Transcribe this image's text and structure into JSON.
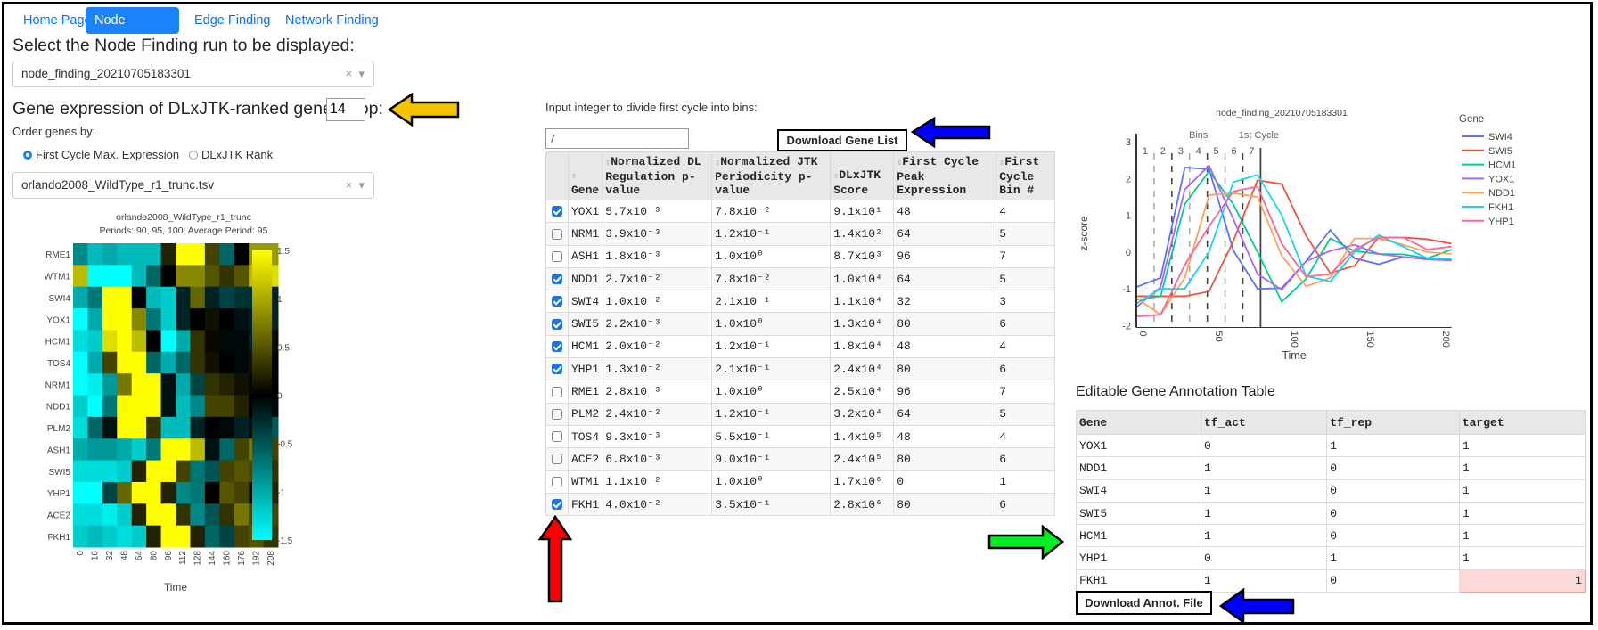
{
  "nav": {
    "tabs": [
      {
        "label": "Home Page",
        "active": false
      },
      {
        "label": "Node Finding",
        "active": true
      },
      {
        "label": "Edge Finding",
        "active": false
      },
      {
        "label": "Network Finding",
        "active": false
      }
    ]
  },
  "left": {
    "run_heading": "Select the Node Finding run to be displayed:",
    "run_select_value": "node_finding_20210705183301",
    "clear_icon": "×",
    "caret_icon": "▾",
    "expr_heading": "Gene expression of DLxJTK-ranked genes. Top:",
    "top_value": "14",
    "order_label": "Order genes by:",
    "order_options": [
      {
        "label": "First Cycle Max. Expression",
        "selected": true
      },
      {
        "label": "DLxJTK Rank",
        "selected": false
      }
    ],
    "dataset_select_value": "orlando2008_WildType_r1_trunc.tsv"
  },
  "middle": {
    "bins_label": "Input integer to divide first cycle into bins:",
    "bins_value": "7",
    "download_gene_list": "Download Gene List",
    "columns": [
      "Gene",
      "Normalized DL Regulation p-value",
      "Normalized JTK Periodicity p-value",
      "DLxJTK Score",
      "First Cycle Peak Expression",
      "First Cycle Bin #"
    ],
    "rows": [
      {
        "checked": true,
        "gene": "YOX1",
        "dl": "5.7x10⁻³",
        "jtk": "7.8x10⁻²",
        "score": "9.1x10¹",
        "peak": "48",
        "bin": "4"
      },
      {
        "checked": false,
        "gene": "NRM1",
        "dl": "3.9x10⁻³",
        "jtk": "1.2x10⁻¹",
        "score": "1.4x10²",
        "peak": "64",
        "bin": "5"
      },
      {
        "checked": false,
        "gene": "ASH1",
        "dl": "1.8x10⁻³",
        "jtk": "1.0x10⁰",
        "score": "8.7x10³",
        "peak": "96",
        "bin": "7"
      },
      {
        "checked": true,
        "gene": "NDD1",
        "dl": "2.7x10⁻²",
        "jtk": "7.8x10⁻²",
        "score": "1.0x10⁴",
        "peak": "64",
        "bin": "5"
      },
      {
        "checked": true,
        "gene": "SWI4",
        "dl": "1.0x10⁻²",
        "jtk": "2.1x10⁻¹",
        "score": "1.1x10⁴",
        "peak": "32",
        "bin": "3"
      },
      {
        "checked": true,
        "gene": "SWI5",
        "dl": "2.2x10⁻³",
        "jtk": "1.0x10⁰",
        "score": "1.3x10⁴",
        "peak": "80",
        "bin": "6"
      },
      {
        "checked": true,
        "gene": "HCM1",
        "dl": "2.0x10⁻²",
        "jtk": "1.2x10⁻¹",
        "score": "1.8x10⁴",
        "peak": "48",
        "bin": "4"
      },
      {
        "checked": true,
        "gene": "YHP1",
        "dl": "1.3x10⁻²",
        "jtk": "2.1x10⁻¹",
        "score": "2.4x10⁴",
        "peak": "80",
        "bin": "6"
      },
      {
        "checked": false,
        "gene": "RME1",
        "dl": "2.8x10⁻³",
        "jtk": "1.0x10⁰",
        "score": "2.5x10⁴",
        "peak": "96",
        "bin": "7"
      },
      {
        "checked": false,
        "gene": "PLM2",
        "dl": "2.4x10⁻²",
        "jtk": "1.2x10⁻¹",
        "score": "3.2x10⁴",
        "peak": "64",
        "bin": "5"
      },
      {
        "checked": false,
        "gene": "TOS4",
        "dl": "9.3x10⁻³",
        "jtk": "5.5x10⁻¹",
        "score": "1.4x10⁵",
        "peak": "48",
        "bin": "4"
      },
      {
        "checked": false,
        "gene": "ACE2",
        "dl": "6.8x10⁻³",
        "jtk": "9.0x10⁻¹",
        "score": "2.4x10⁵",
        "peak": "80",
        "bin": "6"
      },
      {
        "checked": false,
        "gene": "WTM1",
        "dl": "1.1x10⁻²",
        "jtk": "1.0x10⁰",
        "score": "1.7x10⁶",
        "peak": "0",
        "bin": "1"
      },
      {
        "checked": true,
        "gene": "FKH1",
        "dl": "4.0x10⁻²",
        "jtk": "3.5x10⁻¹",
        "score": "2.8x10⁶",
        "peak": "80",
        "bin": "6"
      }
    ]
  },
  "annotation": {
    "title": "Editable Gene Annotation Table",
    "columns": [
      "Gene",
      "tf_act",
      "tf_rep",
      "target"
    ],
    "rows": [
      [
        "YOX1",
        "0",
        "1",
        "1"
      ],
      [
        "NDD1",
        "1",
        "0",
        "1"
      ],
      [
        "SWI4",
        "1",
        "0",
        "1"
      ],
      [
        "SWI5",
        "1",
        "0",
        "1"
      ],
      [
        "HCM1",
        "1",
        "0",
        "1"
      ],
      [
        "YHP1",
        "0",
        "1",
        "1"
      ],
      [
        "FKH1",
        "1",
        "0",
        "1"
      ]
    ],
    "download_label": "Download Annot. File"
  },
  "arrows": {
    "yellow": "#f5c400",
    "blue": "#0000ff",
    "red": "#ff0000",
    "green": "#00ee22"
  },
  "chart_data": [
    {
      "type": "heatmap",
      "title": "orlando2008_WildType_r1_trunc",
      "subtitle": "Periods: 90, 95, 100; Average Period: 95",
      "xlabel": "Time",
      "x": [
        0,
        16,
        32,
        48,
        64,
        80,
        96,
        112,
        128,
        144,
        160,
        176,
        192,
        208
      ],
      "y": [
        "RME1",
        "WTM1",
        "SWI4",
        "YOX1",
        "HCM1",
        "TOS4",
        "NRM1",
        "NDD1",
        "PLM2",
        "ASH1",
        "SWI5",
        "YHP1",
        "ACE2",
        "FKH1"
      ],
      "z": [
        [
          -0.8,
          -1.1,
          -1.0,
          -1.1,
          -1.1,
          -1.1,
          0.2,
          1.5,
          1.5,
          0.4,
          -0.6,
          0.0,
          0.9,
          0.9
        ],
        [
          1.1,
          -1.5,
          -1.5,
          -1.5,
          -1.1,
          -0.6,
          0.0,
          0.8,
          0.8,
          0.5,
          0.3,
          0.5,
          1.1,
          1.3
        ],
        [
          -1.0,
          -0.7,
          1.5,
          1.5,
          0.0,
          -1.1,
          -1.2,
          -0.2,
          0.6,
          -0.2,
          -0.4,
          -0.3,
          -0.3,
          -0.2
        ],
        [
          -1.5,
          -1.0,
          1.5,
          1.5,
          0.8,
          -0.7,
          -1.2,
          -0.2,
          0.0,
          0.1,
          0.0,
          -0.1,
          -0.2,
          -0.2
        ],
        [
          -1.3,
          -1.2,
          1.3,
          1.5,
          1.1,
          0.0,
          -1.5,
          -1.0,
          0.3,
          0.05,
          -0.05,
          -0.05,
          -0.2,
          0.05
        ],
        [
          -1.5,
          -1.0,
          0.4,
          1.5,
          1.5,
          -0.6,
          -1.0,
          -0.6,
          0.3,
          0.1,
          0.0,
          -0.05,
          0.1,
          0.0
        ],
        [
          -1.5,
          -1.4,
          -0.9,
          0.7,
          1.5,
          1.5,
          -0.1,
          -1.0,
          -0.4,
          0.3,
          0.2,
          0.1,
          -0.05,
          0.0
        ],
        [
          -1.2,
          -1.5,
          -0.7,
          1.5,
          1.5,
          1.5,
          -0.1,
          -1.1,
          -0.8,
          0.4,
          0.4,
          0.2,
          0.0,
          -0.05
        ],
        [
          -1.3,
          -0.6,
          -0.1,
          1.5,
          1.5,
          0.3,
          -1.1,
          -1.1,
          -0.2,
          0.0,
          -0.05,
          -0.2,
          -0.1,
          -0.5
        ],
        [
          -1.0,
          -0.9,
          -0.9,
          -1.0,
          -1.2,
          -0.7,
          1.5,
          1.5,
          1.1,
          -0.1,
          -0.6,
          0.4,
          0.7,
          0.4
        ],
        [
          -1.3,
          -1.3,
          -1.3,
          -1.2,
          0.2,
          1.5,
          1.5,
          0.4,
          -0.7,
          -0.5,
          0.4,
          0.5,
          0.4,
          0.3
        ],
        [
          -1.5,
          -1.5,
          -0.4,
          0.6,
          1.5,
          1.5,
          0.2,
          -0.8,
          -0.7,
          0.0,
          0.5,
          0.4,
          0.1,
          0.2
        ],
        [
          -1.3,
          -1.3,
          -1.4,
          -1.2,
          0.2,
          1.5,
          1.5,
          0.3,
          -0.8,
          -0.5,
          0.3,
          0.7,
          0.4,
          0.4
        ],
        [
          -1.2,
          -1.1,
          -1.2,
          -1.3,
          -1.2,
          0.2,
          1.5,
          1.5,
          0.2,
          -0.6,
          -0.4,
          0.4,
          0.5,
          0.3
        ]
      ],
      "zlim": [
        -1.5,
        1.5
      ],
      "colorscale": [
        "#00ffff",
        "#000000",
        "#ffff00"
      ],
      "colorbar_ticks": [
        1.5,
        1,
        0.5,
        0,
        -0.5,
        -1,
        -1.5
      ]
    },
    {
      "type": "line",
      "title": "node_finding_20210705183301",
      "xlabel": "Time",
      "ylabel": "z-score",
      "legend_title": "Gene",
      "legend_position": "right",
      "xlim": [
        0,
        208
      ],
      "ylim": [
        -2,
        3.2
      ],
      "xticks": [
        0,
        50,
        100,
        150,
        200
      ],
      "yticks": [
        -2,
        -1,
        0,
        1,
        2,
        3
      ],
      "x": [
        0,
        16,
        32,
        48,
        64,
        80,
        96,
        112,
        128,
        144,
        160,
        176,
        192,
        208
      ],
      "series": [
        {
          "name": "SWI4",
          "color": "#636efa",
          "values": [
            -0.95,
            -0.7,
            2.3,
            2.25,
            0.05,
            -1.0,
            -0.98,
            -0.25,
            0.6,
            -0.17,
            -0.33,
            -0.13,
            -0.2,
            -0.2
          ]
        },
        {
          "name": "SWI5",
          "color": "#ef553b",
          "values": [
            -1.2,
            -1.2,
            -1.2,
            -1.07,
            0.3,
            1.95,
            1.85,
            0.45,
            -0.57,
            -0.37,
            0.4,
            0.4,
            0.35,
            0.23
          ]
        },
        {
          "name": "HCM1",
          "color": "#00cc96",
          "values": [
            -1.3,
            -1.2,
            1.3,
            2.2,
            1.3,
            0.0,
            -1.35,
            -0.73,
            0.37,
            0.03,
            -0.05,
            -0.06,
            -0.17,
            0.07
          ]
        },
        {
          "name": "YOX1",
          "color": "#ab63fa",
          "values": [
            -1.5,
            -0.95,
            1.7,
            2.35,
            0.9,
            -0.6,
            -1.02,
            -0.25,
            0.03,
            0.2,
            -0.05,
            -0.13,
            -0.2,
            -0.23
          ]
        },
        {
          "name": "NDD1",
          "color": "#ffa15a",
          "values": [
            -1.25,
            -1.7,
            -0.7,
            1.55,
            1.6,
            1.5,
            -0.1,
            -0.93,
            -0.7,
            0.37,
            0.37,
            0.2,
            0.0,
            -0.05
          ]
        },
        {
          "name": "FKH1",
          "color": "#19d3f3",
          "values": [
            -1.4,
            -1.0,
            -1.0,
            0.0,
            1.9,
            2.1,
            1.0,
            -0.65,
            -0.8,
            0.0,
            0.46,
            0.15,
            -0.17,
            -0.18
          ]
        },
        {
          "name": "YHP1",
          "color": "#ff6692",
          "values": [
            -1.75,
            -1.7,
            -0.35,
            0.7,
            1.65,
            1.78,
            0.23,
            -0.67,
            -0.6,
            0.07,
            0.4,
            0.4,
            0.07,
            0.15
          ]
        }
      ],
      "annotations": {
        "bins_label": "Bins",
        "cycle_label": "1st Cycle",
        "bin_count": 7,
        "first_cycle_end": 82,
        "bin_labels": [
          "1",
          "2",
          "3",
          "4",
          "5",
          "6",
          "7"
        ]
      }
    }
  ]
}
